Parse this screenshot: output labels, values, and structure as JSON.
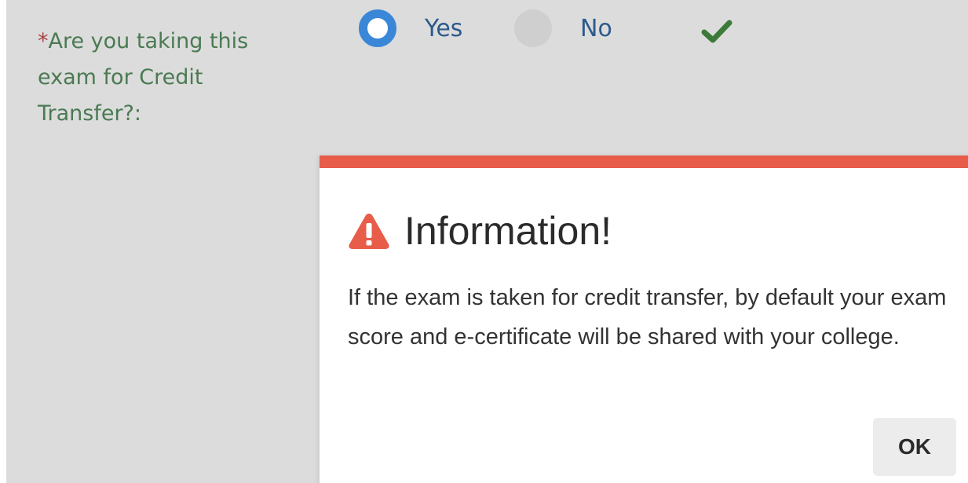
{
  "question": {
    "required_marker": "*",
    "label": "Are you taking this exam for Credit Transfer?:",
    "options": [
      {
        "label": "Yes",
        "selected": true
      },
      {
        "label": "No",
        "selected": false
      }
    ],
    "valid_icon": "check-icon"
  },
  "dialog": {
    "icon": "warning-triangle-icon",
    "title": "Information!",
    "message": "If the exam is taken for credit transfer, by default your exam score and e-certificate will be shared with your college.",
    "ok_label": "OK"
  },
  "colors": {
    "page_background": "#dcdcdc",
    "label_text": "#4a7a52",
    "required_marker": "#a94442",
    "radio_selected": "#3a87d8",
    "radio_text": "#2c5a8c",
    "valid_check": "#3c7a3a",
    "dialog_accent": "#e85c4a",
    "warning_icon": "#e85c4a"
  }
}
